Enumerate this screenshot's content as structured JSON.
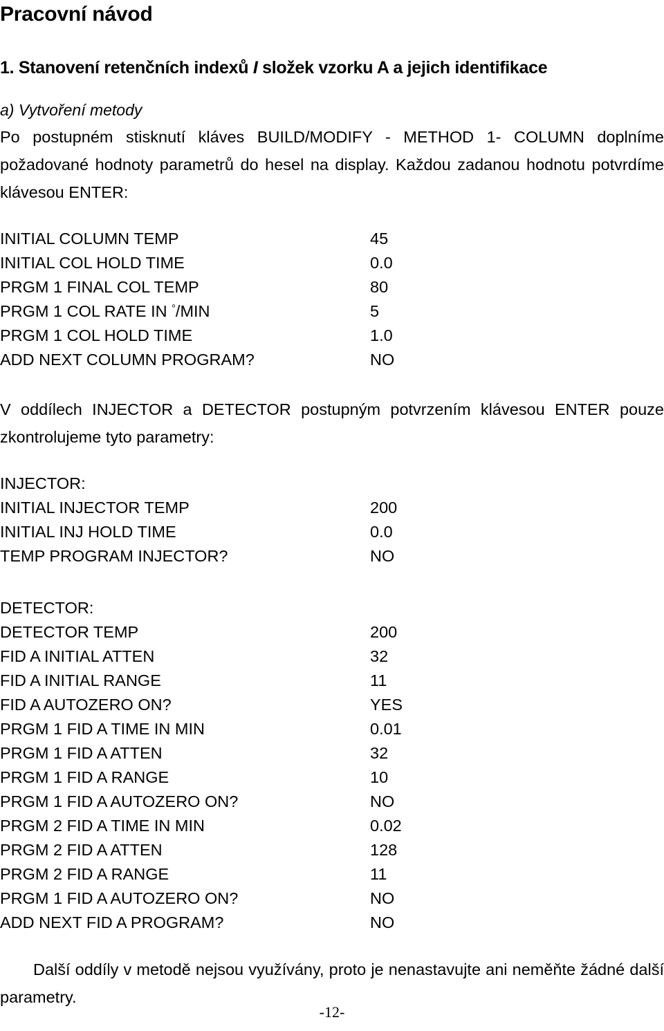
{
  "document": {
    "title": "Pracovní návod",
    "section_heading": {
      "number": "1.",
      "text_before": "Stanovení retenčních indexů",
      "separator": "I",
      "text_after": "složek vzorku A a jejich identifikace",
      "full": "1. Stanovení retenčních indexů I složek vzorku A a jejich identifikace"
    },
    "subheading": "a) Vytvoření metody",
    "intro_paragraph": "Po postupném stisknutí kláves BUILD/MODIFY - METHOD 1- COLUMN doplníme požadované hodnoty parametrů do hesel na display. Každou zadanou hodnotu potvrdíme klávesou ENTER:",
    "column_params": [
      {
        "label": "INITIAL COLUMN TEMP",
        "value": "45"
      },
      {
        "label": "INITIAL COL HOLD TIME",
        "value": "0.0"
      },
      {
        "label": "PRGM 1 FINAL COL TEMP",
        "value": "80"
      },
      {
        "label": "PRGM 1 COL RATE IN °/MIN",
        "value": "5"
      },
      {
        "label": "PRGM 1 COL HOLD TIME",
        "value": "1.0"
      },
      {
        "label": "ADD NEXT COLUMN PROGRAM?",
        "value": "NO"
      }
    ],
    "middle_paragraph": "V oddílech INJECTOR a DETECTOR postupným potvrzením klávesou ENTER pouze zkontrolujeme tyto parametry:",
    "injector_block_label": "INJECTOR:",
    "injector_params": [
      {
        "label": "INITIAL INJECTOR TEMP",
        "value": "200"
      },
      {
        "label": "INITIAL INJ HOLD TIME",
        "value": "0.0"
      },
      {
        "label": "TEMP PROGRAM INJECTOR?",
        "value": "NO"
      }
    ],
    "detector_block_label": "DETECTOR:",
    "detector_params": [
      {
        "label": "DETECTOR TEMP",
        "value": "200"
      },
      {
        "label": "FID A INITIAL ATTEN",
        "value": "32"
      },
      {
        "label": "FID A INITIAL RANGE",
        "value": "11"
      },
      {
        "label": "FID A AUTOZERO ON?",
        "value": "YES"
      },
      {
        "label": "PRGM 1 FID A TIME IN MIN",
        "value": "0.01"
      },
      {
        "label": "PRGM 1 FID A ATTEN",
        "value": "32"
      },
      {
        "label": "PRGM 1 FID A RANGE",
        "value": "10"
      },
      {
        "label": "PRGM 1 FID A AUTOZERO ON?",
        "value": "NO"
      },
      {
        "label": "PRGM 2 FID A TIME IN MIN",
        "value": "0.02"
      },
      {
        "label": "PRGM 2 FID A ATTEN",
        "value": "128"
      },
      {
        "label": "PRGM 2 FID A RANGE",
        "value": "11"
      },
      {
        "label": "PRGM 1 FID A AUTOZERO ON?",
        "value": "NO"
      },
      {
        "label": "ADD NEXT FID A PROGRAM?",
        "value": "NO"
      }
    ],
    "closing_paragraph": "Další oddíly v metodě nejsou využívány, proto je nenastavujte ani neměňte žádné další parametry.",
    "page_number": "-12-"
  }
}
